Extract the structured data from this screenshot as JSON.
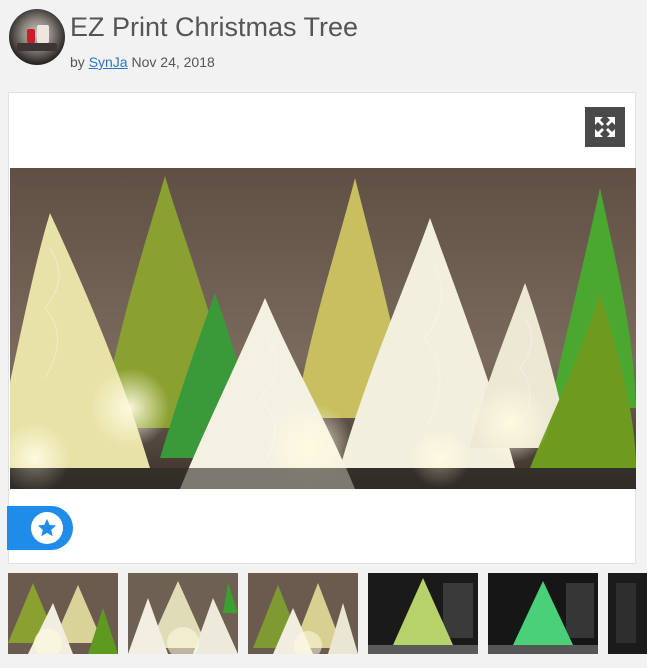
{
  "header": {
    "title": "EZ Print Christmas Tree",
    "by_label": "by",
    "author": "SynJa",
    "date": "Nov 24, 2018"
  },
  "icons": {
    "expand": "expand-arrows-icon",
    "favorite": "star-icon",
    "avatar": "user-avatar"
  },
  "colors": {
    "accent": "#1f8ce9",
    "link": "#2a74c9",
    "title_text": "#555555",
    "expand_bg": "#4a4a4a",
    "page_bg": "#f2f2f2"
  },
  "gallery": {
    "thumbnails": [
      {
        "index": 1,
        "scene": "yellow-trees"
      },
      {
        "index": 2,
        "scene": "white-trees"
      },
      {
        "index": 3,
        "scene": "yellow-trees"
      },
      {
        "index": 4,
        "scene": "green-tree-dark"
      },
      {
        "index": 5,
        "scene": "bright-green-tree-dark"
      },
      {
        "index": 6,
        "scene": "partial"
      }
    ]
  }
}
